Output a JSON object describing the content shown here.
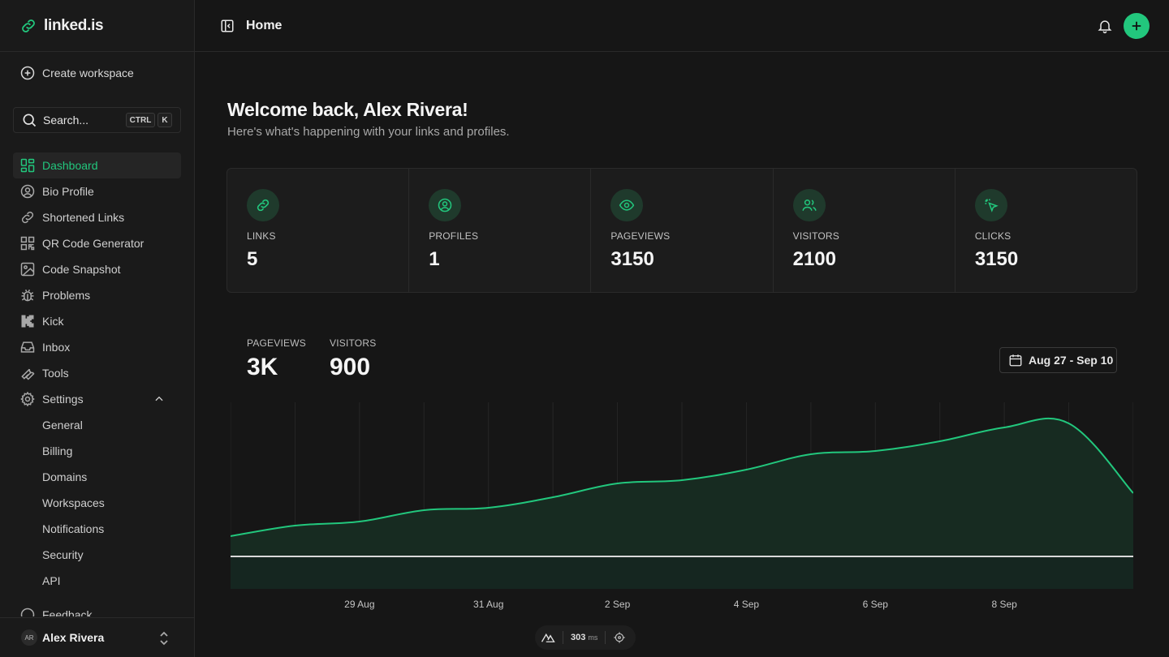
{
  "app": {
    "name": "linked.is",
    "accent": "#22c77d"
  },
  "sidebar": {
    "create_workspace": "Create workspace",
    "search": {
      "label": "Search...",
      "kbd1": "CTRL",
      "kbd2": "K"
    },
    "items": [
      {
        "label": "Dashboard",
        "icon": "dashboard-icon",
        "active": true
      },
      {
        "label": "Bio Profile",
        "icon": "user-circle-icon"
      },
      {
        "label": "Shortened Links",
        "icon": "link-icon"
      },
      {
        "label": "QR Code Generator",
        "icon": "qr-code-icon"
      },
      {
        "label": "Code Snapshot",
        "icon": "image-icon"
      },
      {
        "label": "Problems",
        "icon": "bug-icon"
      },
      {
        "label": "Kick",
        "icon": "kick-icon"
      },
      {
        "label": "Inbox",
        "icon": "inbox-icon"
      },
      {
        "label": "Tools",
        "icon": "wrench-icon"
      },
      {
        "label": "Settings",
        "icon": "gear-icon"
      }
    ],
    "settings_sub": [
      "General",
      "Billing",
      "Domains",
      "Workspaces",
      "Notifications",
      "Security",
      "API"
    ],
    "feedback": "Feedback",
    "user": {
      "initials": "AR",
      "name": "Alex Rivera"
    }
  },
  "header": {
    "title": "Home"
  },
  "main": {
    "welcome": "Welcome back, Alex Rivera!",
    "subtitle": "Here's what's happening with your links and profiles.",
    "stats": [
      {
        "label": "LINKS",
        "value": "5",
        "icon": "link-icon"
      },
      {
        "label": "PROFILES",
        "value": "1",
        "icon": "user-circle-icon"
      },
      {
        "label": "PAGEVIEWS",
        "value": "3150",
        "icon": "eye-icon"
      },
      {
        "label": "VISITORS",
        "value": "2100",
        "icon": "users-icon"
      },
      {
        "label": "CLICKS",
        "value": "3150",
        "icon": "cursor-click-icon"
      }
    ],
    "metrics": {
      "pageviews_label": "PAGEVIEWS",
      "pageviews_value": "3K",
      "visitors_label": "VISITORS",
      "visitors_value": "900"
    },
    "date_range": "Aug 27 - Sep 10"
  },
  "chart_data": {
    "type": "area",
    "x": [
      "Aug 27",
      "Aug 28",
      "Aug 29",
      "Aug 30",
      "Aug 31",
      "Sep 1",
      "Sep 2",
      "Sep 3",
      "Sep 4",
      "Sep 5",
      "Sep 6",
      "Sep 7",
      "Sep 8",
      "Sep 9",
      "Sep 10"
    ],
    "tick_labels": [
      "29 Aug",
      "31 Aug",
      "2 Sep",
      "4 Sep",
      "6 Sep",
      "8 Sep"
    ],
    "series": [
      {
        "name": "PAGEVIEWS",
        "color": "#22c77d",
        "values": [
          65,
          78,
          83,
          97,
          100,
          113,
          130,
          134,
          147,
          166,
          170,
          182,
          199,
          204,
          118
        ]
      },
      {
        "name": "VISITORS",
        "color": "#d9d9d9",
        "values": [
          40,
          40,
          40,
          40,
          40,
          40,
          40,
          40,
          40,
          40,
          40,
          40,
          40,
          40,
          40
        ]
      }
    ],
    "ylim": [
      0,
      230
    ],
    "grid": "vertical"
  },
  "devbar": {
    "value": "303",
    "unit": "ms"
  }
}
